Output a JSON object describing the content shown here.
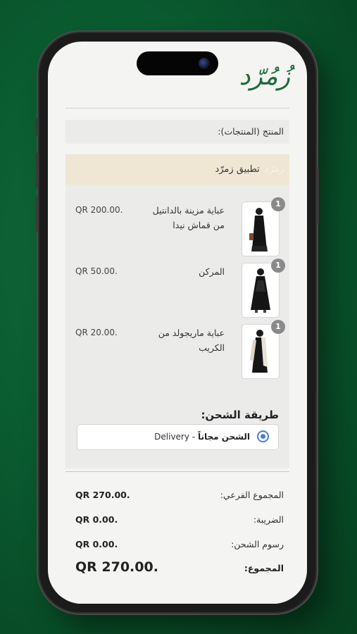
{
  "app": {
    "logo_text": "زُمُرّد",
    "brand_color": "#1e6b3a"
  },
  "order": {
    "products_heading": "المنتج (المنتجات):",
    "store_name": "تطبيق زمرّد",
    "store_mini_logo": "زمرّد",
    "items": [
      {
        "qty": "1",
        "name": "عباية مزينة بالدانتيل من قماش نيدا",
        "price": "QR 200.00."
      },
      {
        "qty": "1",
        "name": "المركن",
        "price": "QR 50.00."
      },
      {
        "qty": "1",
        "name": "عباية ماريجولد من الكريب",
        "price": "QR 20.00."
      }
    ],
    "shipping": {
      "title": "طريقة الشحن:",
      "method": "Delivery",
      "separator": " - ",
      "note": "الشحن مجاناً",
      "selected": true
    },
    "totals": {
      "subtotal_label": "المجموع الفرعي:",
      "subtotal_value": "QR 270.00.",
      "tax_label": "الضريبة:",
      "tax_value": "QR 0.00.",
      "shipping_label": "رسوم الشحن:",
      "shipping_value": "QR 0.00.",
      "total_label": "المجموع:",
      "total_value": "QR 270.00."
    }
  }
}
